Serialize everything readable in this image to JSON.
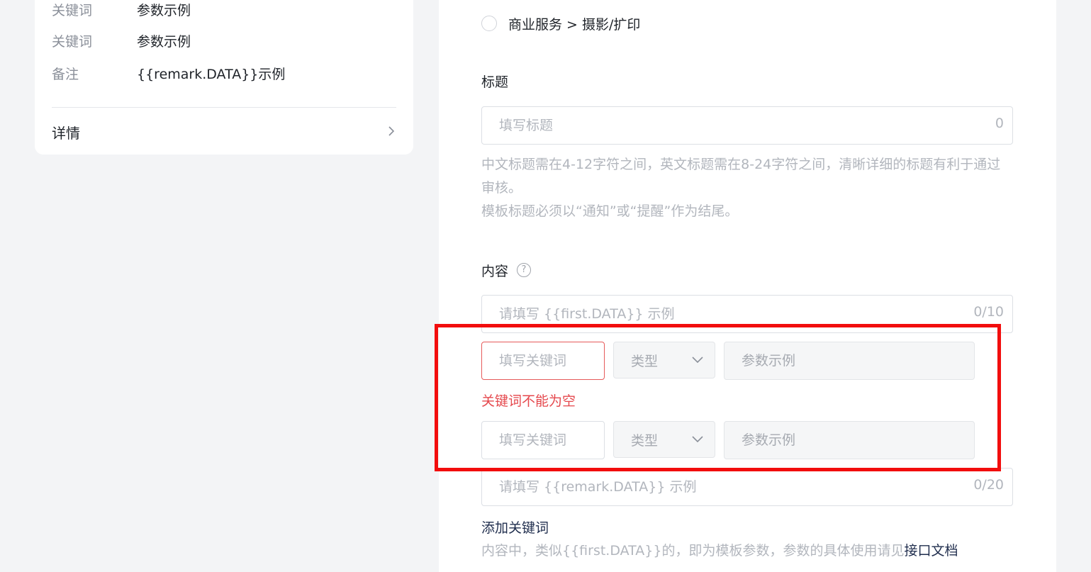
{
  "preview": {
    "rows": [
      {
        "key": "关键词",
        "value": "参数示例"
      },
      {
        "key": "关键词",
        "value": "参数示例"
      },
      {
        "key": "备注",
        "value": "{{remark.DATA}}示例"
      }
    ],
    "detail_label": "详情"
  },
  "form": {
    "category_option": "商业服务 > 摄影/扩印",
    "title_section": {
      "label": "标题",
      "placeholder": "填写标题",
      "counter": "0",
      "hint_line1": "中文标题需在4-12字符之间，英文标题需在8-24字符之间，清晰详细的标题有利于通过审核。",
      "hint_line2": "模板标题必须以“通知”或“提醒”作为结尾。"
    },
    "content_section": {
      "label": "内容",
      "help_symbol": "?",
      "first_placeholder": "请填写 {{first.DATA}} 示例",
      "first_counter": "0/10",
      "keyword_rows": [
        {
          "keyword_placeholder": "填写关键词",
          "type_label": "类型",
          "param_placeholder": "参数示例",
          "error": "关键词不能为空"
        },
        {
          "keyword_placeholder": "填写关键词",
          "type_label": "类型",
          "param_placeholder": "参数示例"
        }
      ],
      "remark_placeholder": "请填写 {{remark.DATA}} 示例",
      "remark_counter": "0/20",
      "add_keyword_label": "添加关键词",
      "footer_hint": "内容中，类似{{first.DATA}}的，即为模板参数，参数的具体使用请见",
      "doc_link_label": "接口文档"
    }
  },
  "colors": {
    "highlight_border": "#f20d0d",
    "error_text": "#e5484d",
    "link": "#1f2d4d"
  }
}
